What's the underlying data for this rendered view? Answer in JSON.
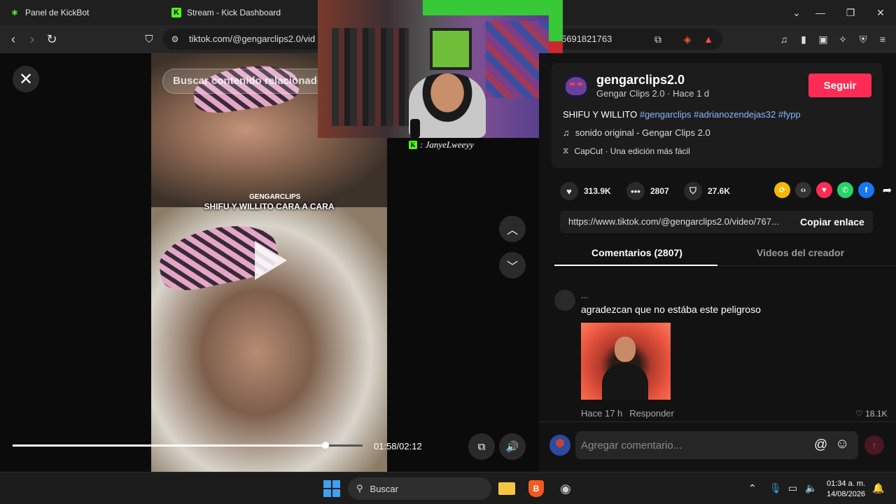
{
  "browser": {
    "tabs": [
      {
        "label": "Panel de KickBot",
        "icon": "kickbot-icon"
      },
      {
        "label": "Stream - Kick Dashboard",
        "icon": "kick-icon"
      }
    ],
    "url": "tiktok.com/@gengarclips2.0/vid",
    "url_tail": "5691821763"
  },
  "video": {
    "search_overlay": "Buscar contenido relacionado",
    "watermark": "GENGARCLIPS",
    "caption": "SHIFU Y WILLITO CARA A CARA",
    "time": "01:58/02:12",
    "progress": 0.893
  },
  "webcam": {
    "streamer_name": ": JanyeLweeyy"
  },
  "post": {
    "username": "gengarclips2.0",
    "subline": "Gengar Clips 2.0 · Hace 1 d",
    "follow_label": "Seguir",
    "description_prefix": "SHIFU Y WILLITO ",
    "description_tags": "#gengarclips #adrianozendejas32 #fypp",
    "music": "sonido original - Gengar Clips 2.0",
    "capcut": "CapCut · Una edición más fácil",
    "likes": "313.9K",
    "comments_count": "2807",
    "saves": "27.6K",
    "link": "https://www.tiktok.com/@gengarclips2.0/video/767...",
    "copy_label": "Copiar enlace"
  },
  "panel_tabs": {
    "comments": "Comentarios (2807)",
    "creator_videos": "Videos del creador"
  },
  "comment": {
    "user": "...",
    "text": "agradezcan que no estába este peligroso",
    "time": "Hace 17 h",
    "reply": "Responder",
    "likes": "18.1K"
  },
  "composer": {
    "placeholder": "Agregar comentario..."
  },
  "taskbar": {
    "search_label": "Buscar",
    "time": "01:34 a. m.",
    "date": "14/08/2026"
  },
  "colors": {
    "follow": "#fe2c55",
    "tags": "#8ab6ff",
    "kick_green": "#53fc18"
  }
}
